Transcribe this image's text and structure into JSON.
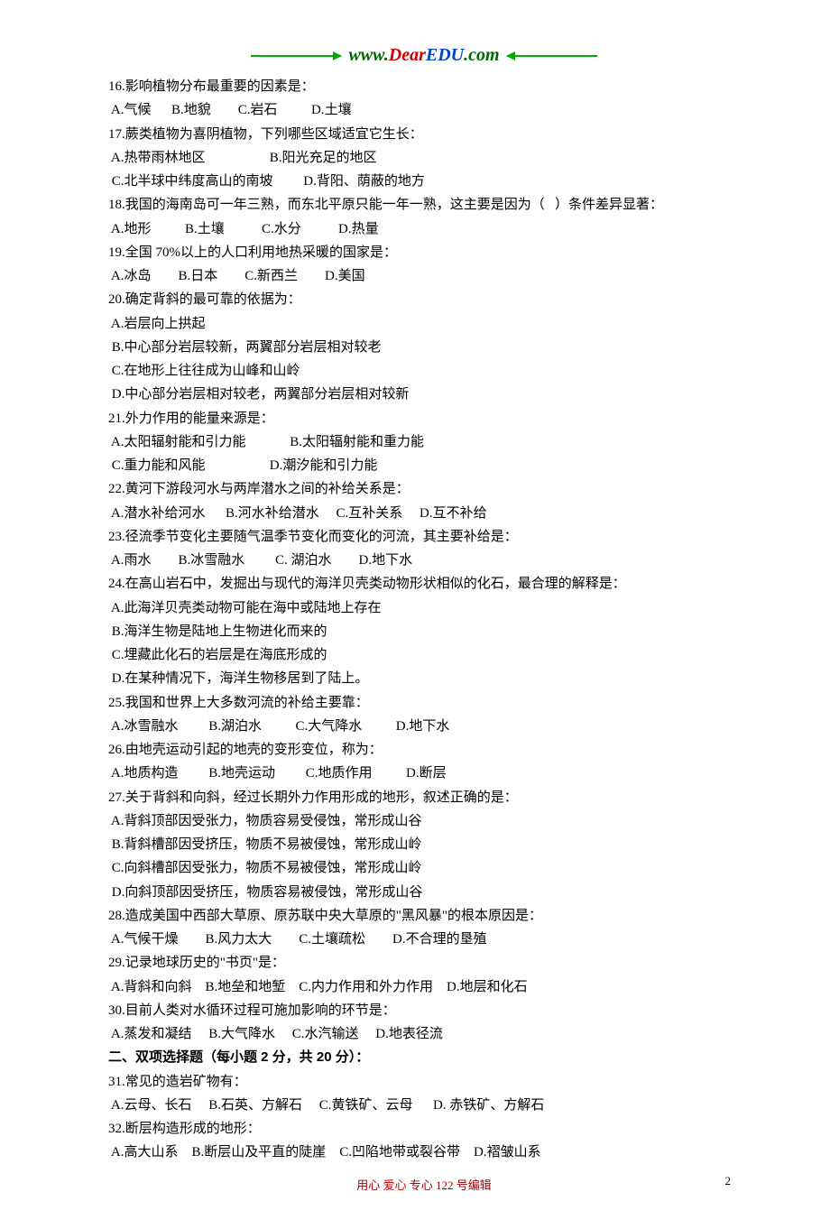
{
  "header": {
    "url_www": "www.",
    "url_dear": "Dear",
    "url_edu": "EDU",
    "url_com": ".com"
  },
  "lines": {
    "q16": "16.影响植物分布最重要的因素是：",
    "q16o": " A.气候      B.地貌        C.岩石          D.土壤",
    "q17": "17.蕨类植物为喜阴植物，下列哪些区域适宜它生长：",
    "q17a": " A.热带雨林地区                   B.阳光充足的地区",
    "q17b": " C.北半球中纬度高山的南坡         D.背阳、荫蔽的地方",
    "q18": "18.我国的海南岛可一年三熟，而东北平原只能一年一熟，这主要是因为（   ）条件差异显著：",
    "q18o": " A.地形          B.土壤           C.水分           D.热量",
    "q19": "19.全国 70%以上的人口利用地热采暖的国家是：",
    "q19o": " A.冰岛        B.日本        C.新西兰        D.美国",
    "q20": "20.确定背斜的最可靠的依据为：",
    "q20a": " A.岩层向上拱起",
    "q20b": " B.中心部分岩层较新，两翼部分岩层相对较老",
    "q20c": " C.在地形上往往成为山峰和山岭",
    "q20d": " D.中心部分岩层相对较老，两翼部分岩层相对较新",
    "q21": "21.外力作用的能量来源是：",
    "q21a": " A.太阳辐射能和引力能             B.太阳辐射能和重力能",
    "q21b": " C.重力能和风能                   D.潮汐能和引力能",
    "q22": "22.黄河下游段河水与两岸潜水之间的补给关系是：",
    "q22o": " A.潜水补给河水      B.河水补给潜水     C.互补关系     D.互不补给",
    "q23": "23.径流季节变化主要随气温季节变化而变化的河流，其主要补给是：",
    "q23o": " A.雨水        B.冰雪融水         C. 湖泊水        D.地下水",
    "q24": "24.在高山岩石中，发掘出与现代的海洋贝壳类动物形状相似的化石，最合理的解释是：",
    "q24a": " A.此海洋贝壳类动物可能在海中或陆地上存在",
    "q24b": " B.海洋生物是陆地上生物进化而来的",
    "q24c": " C.埋藏此化石的岩层是在海底形成的",
    "q24d": " D.在某种情况下，海洋生物移居到了陆上。",
    "q25": "25.我国和世界上大多数河流的补给主要靠：",
    "q25o": " A.冰雪融水         B.湖泊水          C.大气降水          D.地下水",
    "q26": "26.由地壳运动引起的地壳的变形变位，称为：",
    "q26o": " A.地质构造         B.地壳运动         C.地质作用          D.断层",
    "q27": "27.关于背斜和向斜，经过长期外力作用形成的地形，叙述正确的是：",
    "q27a": " A.背斜顶部因受张力，物质容易受侵蚀，常形成山谷",
    "q27b": " B.背斜槽部因受挤压，物质不易被侵蚀，常形成山岭",
    "q27c": " C.向斜槽部因受张力，物质不易被侵蚀，常形成山岭",
    "q27d": " D.向斜顶部因受挤压，物质容易被侵蚀，常形成山谷",
    "q28": "28.造成美国中西部大草原、原苏联中央大草原的\"黑风暴\"的根本原因是：",
    "q28o": " A.气候干燥        B.风力太大        C.土壤疏松        D.不合理的垦殖",
    "q29": "29.记录地球历史的\"书页\"是：",
    "q29o": " A.背斜和向斜    B.地垒和地堑    C.内力作用和外力作用    D.地层和化石",
    "q30": "30.目前人类对水循环过程可施加影响的环节是：",
    "q30o": " A.蒸发和凝结     B.大气降水     C.水汽输送     D.地表径流",
    "section2": "二、双项选择题（每小题 2 分，共 20 分）：",
    "q31": "31.常见的造岩矿物有：",
    "q31o": " A.云母、长石     B.石英、方解石     C.黄铁矿、云母      D. 赤铁矿、方解石",
    "q32": "32.断层构造形成的地形：",
    "q32o": " A.高大山系    B.断层山及平直的陡崖    C.凹陷地带或裂谷带    D.褶皱山系"
  },
  "footer": {
    "text_left": "用心",
    "text_mid": "爱心",
    "text_right": "专心   122 号编辑",
    "page_num": "2"
  }
}
